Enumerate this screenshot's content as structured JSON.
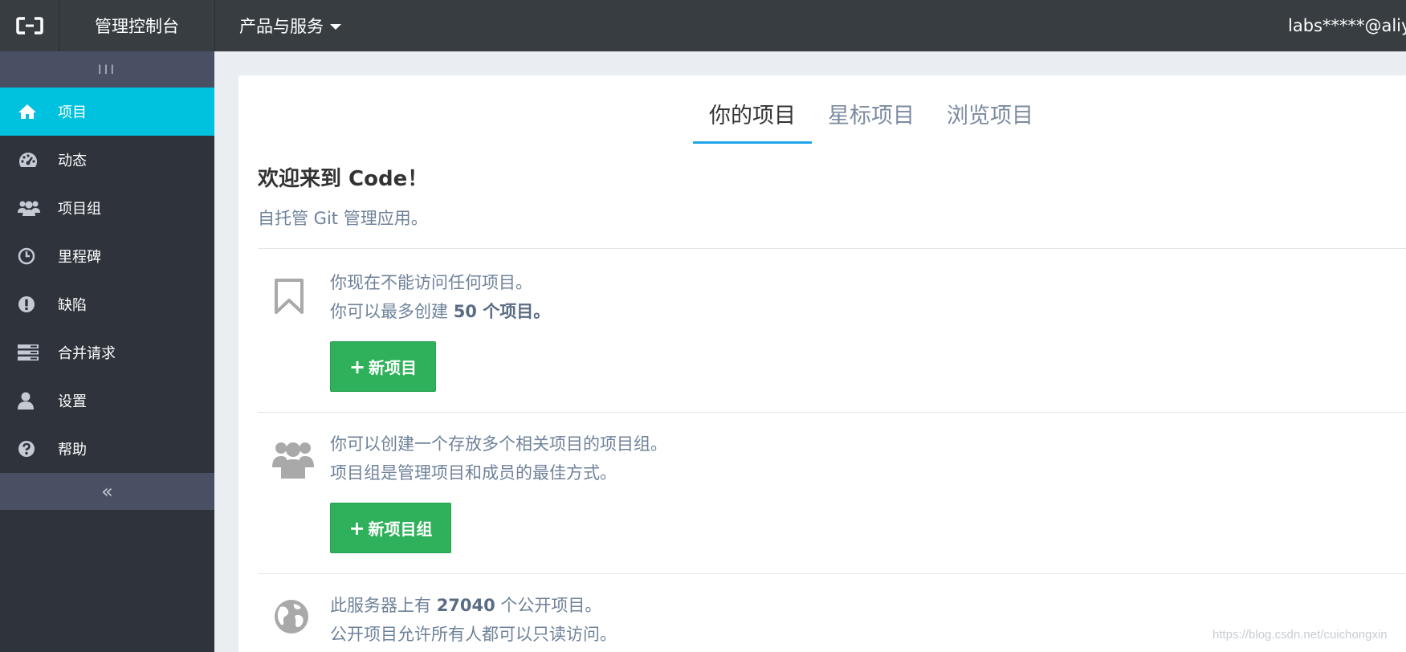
{
  "topbar": {
    "logo_icon": "aliyun-logo-icon",
    "console_title": "管理控制台",
    "products_label": "产品与服务",
    "user_label": "labs*****@aliy"
  },
  "sidebar": {
    "toggle_label": "III",
    "items": [
      {
        "label": "项目",
        "icon": "home-icon",
        "active": true
      },
      {
        "label": "动态",
        "icon": "dashboard-icon"
      },
      {
        "label": "项目组",
        "icon": "group-icon"
      },
      {
        "label": "里程碑",
        "icon": "clock-icon"
      },
      {
        "label": "缺陷",
        "icon": "exclamation-icon"
      },
      {
        "label": "合并请求",
        "icon": "merge-list-icon"
      },
      {
        "label": "设置",
        "icon": "user-icon"
      },
      {
        "label": "帮助",
        "icon": "question-icon"
      }
    ],
    "collapse_label": "«"
  },
  "tabs": [
    "你的项目",
    "星标项目",
    "浏览项目"
  ],
  "welcome": {
    "title": "欢迎来到 Code！",
    "subtitle": "自托管 Git 管理应用。"
  },
  "blocks": {
    "projects": {
      "line1": "你现在不能访问任何项目。",
      "line2_prefix": "你可以最多创建 ",
      "line2_bold": "50 个项目。",
      "button": "新项目"
    },
    "groups": {
      "line1": "你可以创建一个存放多个相关项目的项目组。",
      "line2": "项目组是管理项目和成员的最佳方式。",
      "button": "新项目组"
    },
    "public": {
      "line1_prefix": "此服务器上有 ",
      "line1_bold": "27040",
      "line1_suffix": " 个公开项目。",
      "line2": "公开项目允许所有人都可以只读访问。"
    }
  },
  "watermark": "https://blog.csdn.net/cuichongxin"
}
